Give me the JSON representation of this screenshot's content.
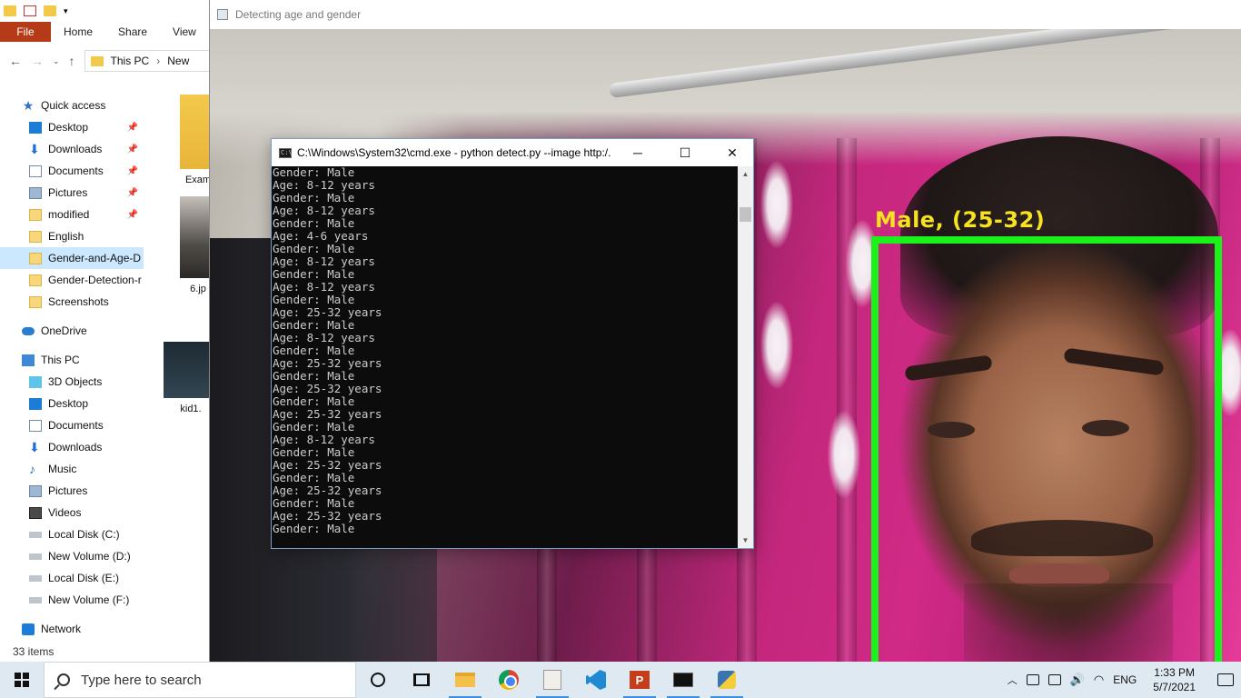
{
  "explorer": {
    "ribbon_tabs": {
      "file": "File",
      "home": "Home",
      "share": "Share",
      "view": "View"
    },
    "address": {
      "crumb1": "This PC",
      "crumb2": "New"
    },
    "nav": {
      "quick_access": "Quick access",
      "desktop": "Desktop",
      "downloads": "Downloads",
      "documents": "Documents",
      "pictures": "Pictures",
      "modified": "modified",
      "english": "English",
      "gender_age": "Gender-and-Age-D",
      "gender_detection": "Gender-Detection-r",
      "screenshots": "Screenshots",
      "onedrive": "OneDrive",
      "this_pc": "This PC",
      "objects3d": "3D Objects",
      "pc_desktop": "Desktop",
      "pc_documents": "Documents",
      "pc_downloads": "Downloads",
      "music": "Music",
      "pc_pictures": "Pictures",
      "videos": "Videos",
      "disk_c": "Local Disk (C:)",
      "disk_d": "New Volume (D:)",
      "disk_e": "Local Disk (E:)",
      "disk_f": "New Volume (F:)",
      "network": "Network"
    },
    "files": {
      "f1": "Exam",
      "f2": "6.jp",
      "f3": "kid1."
    },
    "status": "33 items"
  },
  "image_window": {
    "title": "Detecting age and gender",
    "face_label": "Male, (25-32)"
  },
  "cmd": {
    "title": "C:\\Windows\\System32\\cmd.exe - python  detect.py --image http:/...",
    "lines": [
      "Gender: Male",
      "Age: 8-12 years",
      "Gender: Male",
      "Age: 8-12 years",
      "Gender: Male",
      "Age: 4-6 years",
      "Gender: Male",
      "Age: 8-12 years",
      "Gender: Male",
      "Age: 8-12 years",
      "Gender: Male",
      "Age: 25-32 years",
      "Gender: Male",
      "Age: 8-12 years",
      "Gender: Male",
      "Age: 25-32 years",
      "Gender: Male",
      "Age: 25-32 years",
      "Gender: Male",
      "Age: 25-32 years",
      "Gender: Male",
      "Age: 8-12 years",
      "Gender: Male",
      "Age: 25-32 years",
      "Gender: Male",
      "Age: 25-32 years",
      "Gender: Male",
      "Age: 25-32 years",
      "Gender: Male"
    ]
  },
  "taskbar": {
    "search_placeholder": "Type here to search",
    "language": "ENG",
    "time": "1:33 PM",
    "date": "5/7/2021"
  },
  "colors": {
    "face_box": "#1bf21b",
    "face_label": "#f6e21e",
    "file_tab": "#b53a17"
  }
}
